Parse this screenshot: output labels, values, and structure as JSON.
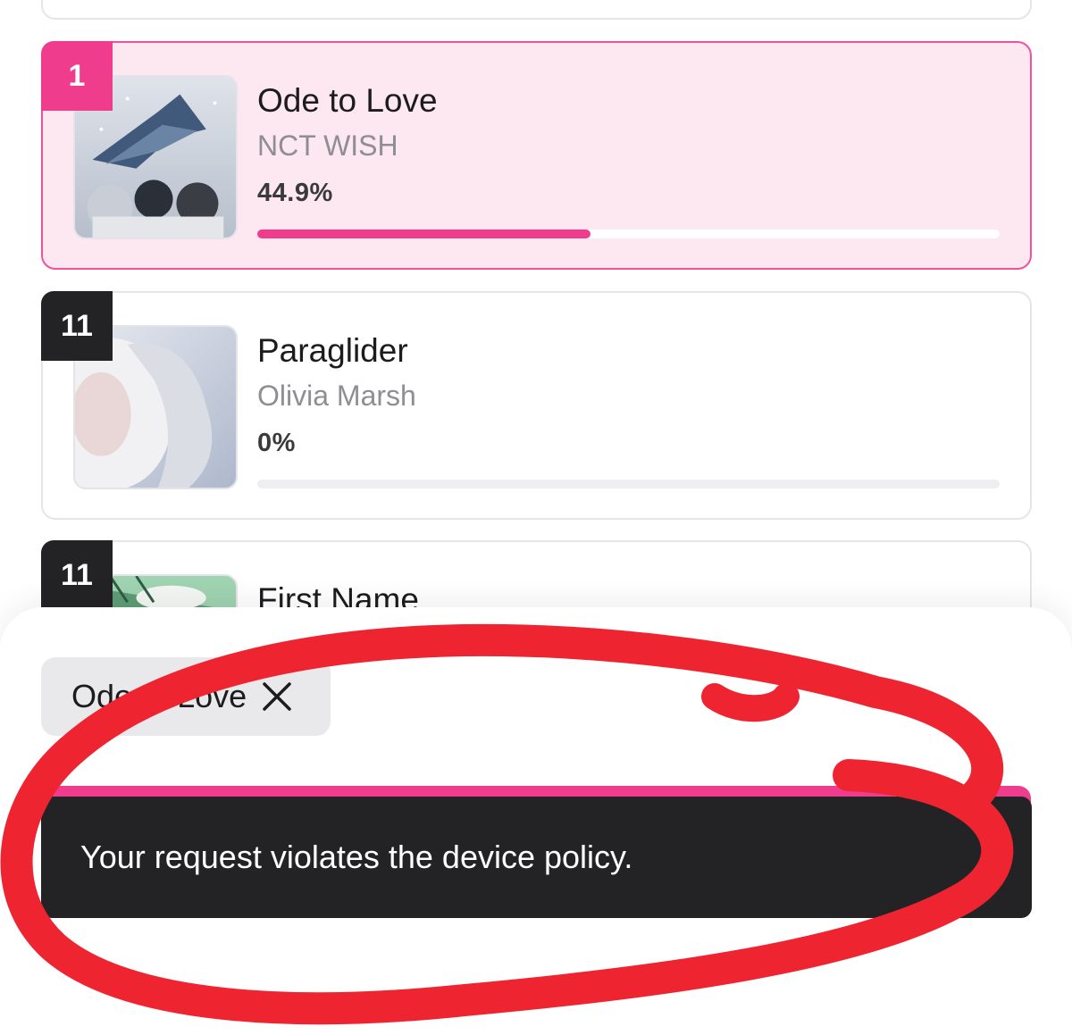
{
  "songs": [
    {
      "rank": "1",
      "title": "Ode to Love",
      "artist": "NCT WISH",
      "percent_label": "44.9%",
      "progress": 0.449
    },
    {
      "rank": "11",
      "title": "Paraglider",
      "artist": "Olivia Marsh",
      "percent_label": "0%",
      "progress": 0
    },
    {
      "rank": "11",
      "title": "First Name"
    }
  ],
  "selected_chip": {
    "label": "Ode to Love"
  },
  "toast": {
    "message": "Your request violates the device policy."
  },
  "icons": {
    "close": "close-icon"
  },
  "colors": {
    "accent": "#f03c8c",
    "selected_bg": "#fde7f1",
    "toast_bg": "#232326",
    "annotation": "#ee2431"
  }
}
